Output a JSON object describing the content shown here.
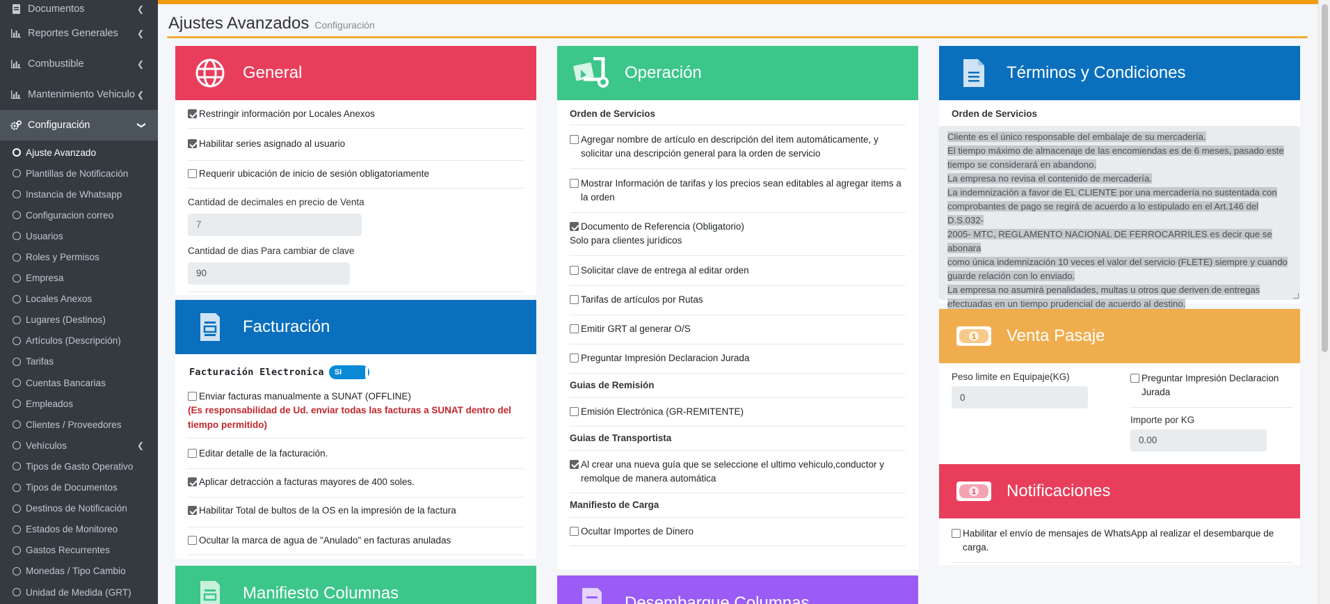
{
  "sidebar": {
    "top_items": [
      {
        "label": "Documentos",
        "icon": "document-icon"
      },
      {
        "label": "Reportes Generales",
        "icon": "bar-chart-icon"
      },
      {
        "label": "Combustible",
        "icon": "bar-chart-icon"
      },
      {
        "label": "Mantenimiento Vehiculo",
        "icon": "bar-chart-icon"
      },
      {
        "label": "Configuración",
        "icon": "gears-icon"
      }
    ],
    "sub_items": [
      "Ajuste Avanzado",
      "Plantillas de Notificación",
      "Instancia de Whatsapp",
      "Configuracion correo",
      "Usuarios",
      "Roles y Permisos",
      "Empresa",
      "Locales Anexos",
      "Lugares (Destinos)",
      "Artículos (Descripción)",
      "Tarifas",
      "Cuentas Bancarias",
      "Empleados",
      "Clientes / Proveedores",
      "Vehículos",
      "Tipos de Gasto Operativo",
      "Tipos de Documentos",
      "Destinos de Notificación",
      "Estados de Monitoreo",
      "Gastos Recurrentes",
      "Monedas / Tipo Cambio",
      "Unidad de Medida (GRT)"
    ]
  },
  "header": {
    "title": "Ajustes Avanzados",
    "subtitle": "Configuración"
  },
  "general": {
    "title": "General",
    "opt1": "Restringir información por Locales Anexos",
    "opt2": "Habilitar series asignado al usuario",
    "opt3": "Requerir ubicación de inicio de sesión obligatoriamente",
    "decimals_label": "Cantidad de decimales en precio de Venta",
    "decimals_value": "7",
    "days_label": "Cantidad de dias Para cambiar de clave",
    "days_value": "90"
  },
  "facturacion": {
    "title": "Facturación",
    "toggle_label": "Facturación Electronica",
    "toggle_value": "SI",
    "opt1": "Enviar facturas manualmente a SUNAT (OFFLINE)",
    "opt1_warning": "(Es responsabilidad de Ud. enviar todas las facturas a SUNAT dentro del tiempo permitido)",
    "opt2": "Editar detalle de la facturación.",
    "opt3": "Aplicar detracción a facturas mayores de 400 soles.",
    "opt4": "Habilitar Total de bultos de la OS en la impresión de la factura",
    "opt5": "Ocultar la marca de agua de \"Anulado\" en facturas anuladas"
  },
  "manifiesto": {
    "title": "Manifiesto Columnas"
  },
  "operacion": {
    "title": "Operación",
    "sec1": "Orden de Servicios",
    "opt1": "Agregar nombre de artículo en descripción del item automáticamente, y solicitar una descripción general para la orden de servicio",
    "opt2": "Mostrar Información de tarifas y los precios sean editables al agregar items a la orden",
    "opt3": "Documento de Referencia (Obligatorio)",
    "opt3_sub": "Solo para clientes jurídicos",
    "opt4": "Solicitar clave de entrega al editar orden",
    "opt5": "Tarifas de artículos por Rutas",
    "opt6": "Emitir GRT al generar O/S",
    "opt7": "Preguntar Impresión Declaracion Jurada",
    "sec2": "Guias de Remisión",
    "opt8": "Emisión Electrónica (GR-REMITENTE)",
    "sec3": "Guias de Transportista",
    "opt9": "Al crear una nueva guía que se seleccione el ultimo vehiculo,conductor y remolque de manera automática",
    "sec4": "Manifiesto de Carga",
    "opt10": "Ocultar Importes de Dinero"
  },
  "desembarque": {
    "title": "Desembarque Columnas"
  },
  "terminos": {
    "title": "Términos y Condiciones",
    "sec": "Orden de Servicios",
    "text_lines": [
      "Cliente es el único responsable del embalaje de su mercadería.",
      "El tiempo máximo de almacenaje de las encomiendas es de 6 meses, pasado este",
      "tiempo se considerará en abandono.",
      "La empresa no revisa el contenido de mercadería.",
      "La indemnización a favor de EL CLIENTE por una mercadería no sustentada con",
      "comprobantes de pago se regirá de acuerdo a lo estipulado en el Art.146 del D.S.032-",
      "2005- MTC, REGLAMENTO NACIONAL DE FERROCARRILES es decir que se abonara",
      "como única indemnización 10 veces el valor del servicio (FLETE) siempre y cuando",
      "guarde relación con lo enviado.",
      "La empresa no asumirá penalidades, multas u otros que deriven de entregas",
      "efectuadas en un tiempo prudencial de acuerdo al destino."
    ]
  },
  "venta": {
    "title": "Venta Pasaje",
    "peso_label": "Peso limite en Equipaje(KG)",
    "peso_value": "0",
    "declaracion": "Preguntar Impresión Declaracion Jurada",
    "importe_label": "Importe por KG",
    "importe_value": "0.00"
  },
  "notificaciones": {
    "title": "Notificaciones",
    "opt1": "Habilitar el envío de mensajes de WhatsApp al realizar el desembarque de carga."
  },
  "colors": {
    "red": "#e83e5c",
    "green": "#3cc68a",
    "blue": "#0a6fbd",
    "orange": "#f0ad4e",
    "purple": "#9b5cf6",
    "accent": "#f39c12"
  }
}
